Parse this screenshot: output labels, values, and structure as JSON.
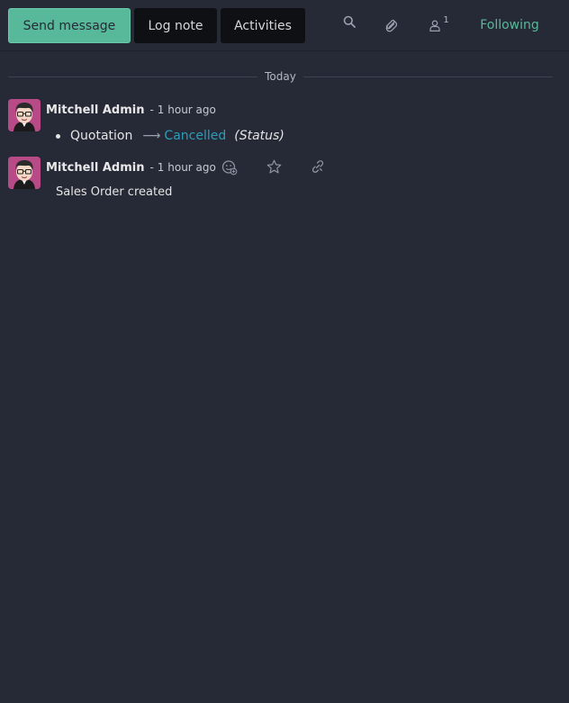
{
  "toolbar": {
    "send_message_label": "Send message",
    "log_note_label": "Log note",
    "activities_label": "Activities",
    "search_icon": "search-icon",
    "attachment_icon": "paperclip-icon",
    "followers_icon": "user-icon",
    "followers_count": "1",
    "following_label": "Following"
  },
  "thread": {
    "date_separator": "Today",
    "messages": [
      {
        "author": "Mitchell Admin",
        "separator": "-",
        "time": "1 hour ago",
        "tracking": {
          "old_value": "Quotation",
          "new_value": "Cancelled",
          "field": "(Status)"
        }
      },
      {
        "author": "Mitchell Admin",
        "separator": "-",
        "time": "1 hour ago",
        "body": "Sales Order created",
        "actions": [
          "add-reaction-icon",
          "star-icon",
          "link-icon"
        ]
      }
    ]
  },
  "colors": {
    "background": "#262a36",
    "primary": "#58b99a",
    "link": "#2e9dbb"
  }
}
